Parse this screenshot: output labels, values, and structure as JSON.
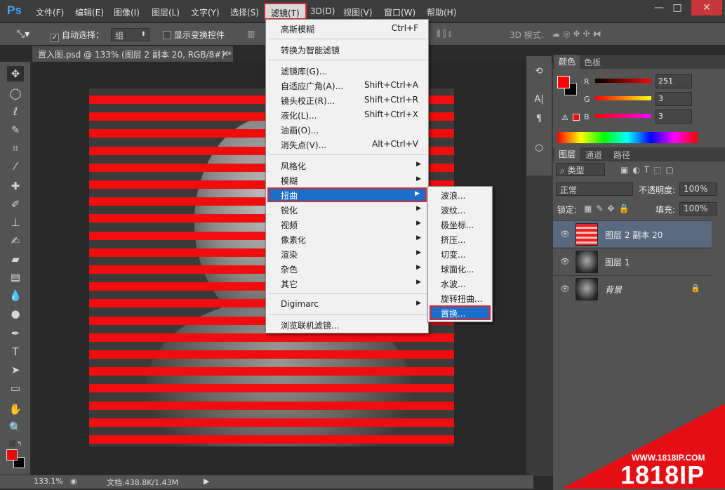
{
  "app": {
    "logo": "Ps",
    "menus": [
      "文件(F)",
      "编辑(E)",
      "图像(I)",
      "图层(L)",
      "文字(Y)",
      "选择(S)",
      "滤镜(T)",
      "3D(D)",
      "视图(V)",
      "窗口(W)",
      "帮助(H)"
    ],
    "window_controls": [
      "—",
      "□",
      "✕"
    ]
  },
  "options": {
    "auto_select_label": "自动选择：",
    "auto_select_value": "组",
    "show_transform_label": "显示变换控件",
    "mode_3d_label": "3D 模式:"
  },
  "document": {
    "tab_title": "置入图.psd @ 133% (图层 2 副本 20, RGB/8#) *",
    "tab_close": "×"
  },
  "filter_menu": {
    "items": [
      {
        "label": "高斯模糊",
        "shortcut": "Ctrl+F"
      },
      {
        "label": "转换为智能滤镜",
        "shortcut": ""
      },
      {
        "label": "滤镜库(G)...",
        "shortcut": ""
      },
      {
        "label": "自适应广角(A)...",
        "shortcut": "Shift+Ctrl+A"
      },
      {
        "label": "镜头校正(R)...",
        "shortcut": "Shift+Ctrl+R"
      },
      {
        "label": "液化(L)...",
        "shortcut": "Shift+Ctrl+X"
      },
      {
        "label": "油画(O)...",
        "shortcut": ""
      },
      {
        "label": "消失点(V)...",
        "shortcut": "Alt+Ctrl+V"
      },
      {
        "label": "风格化"
      },
      {
        "label": "模糊"
      },
      {
        "label": "扭曲"
      },
      {
        "label": "锐化"
      },
      {
        "label": "视频"
      },
      {
        "label": "像素化"
      },
      {
        "label": "渲染"
      },
      {
        "label": "杂色"
      },
      {
        "label": "其它"
      },
      {
        "label": "Digimarc"
      },
      {
        "label": "浏览联机滤镜..."
      }
    ]
  },
  "distort_submenu": {
    "items": [
      "波浪...",
      "波纹...",
      "极坐标...",
      "挤压...",
      "切变...",
      "球面化...",
      "水波...",
      "旋转扭曲...",
      "置换..."
    ]
  },
  "color_panel": {
    "tabs": [
      "颜色",
      "色板"
    ],
    "r_label": "R",
    "g_label": "G",
    "b_label": "B",
    "r": "251",
    "g": "3",
    "b": "3",
    "fg": "#fb0303",
    "bg": "#000000"
  },
  "layers_panel": {
    "tabs": [
      "图层",
      "通道",
      "路径"
    ],
    "kind_label": "类型",
    "blend_mode": "正常",
    "opacity_label": "不透明度:",
    "opacity": "100%",
    "lock_label": "锁定:",
    "fill_label": "填充:",
    "fill": "100%",
    "layers": [
      {
        "name": "图层 2 副本 20",
        "selected": true
      },
      {
        "name": "图层 1",
        "selected": false
      },
      {
        "name": "背景",
        "selected": false
      }
    ]
  },
  "status": {
    "zoom": "133.1%",
    "doc_info": "文档:438.8K/1.43M"
  },
  "watermark": {
    "url": "WWW.1818IP.COM",
    "big": "1818IP"
  }
}
